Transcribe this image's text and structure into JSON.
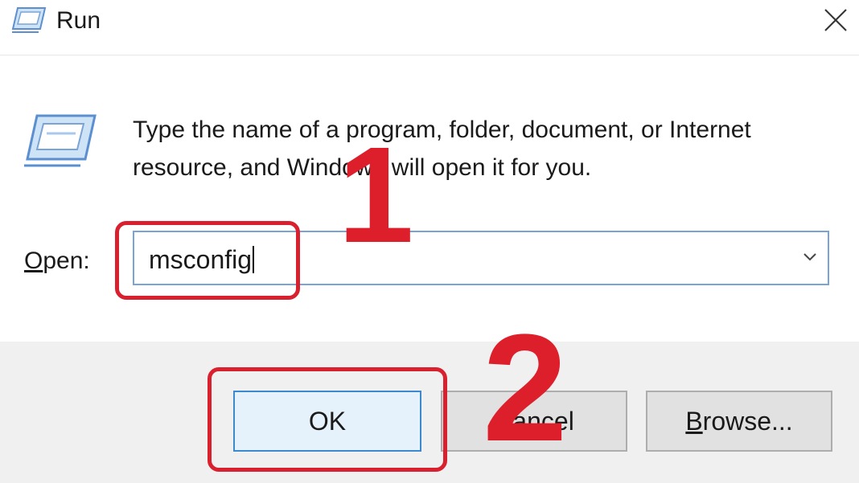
{
  "window": {
    "title": "Run",
    "icon": "run-app-icon",
    "close_icon": "close-icon"
  },
  "dialog": {
    "description": "Type the name of a program, folder, document, or Internet resource, and Windows will open it for you.",
    "description_visible": "Type the name of a program, folder, document, or Internet resource and Windows will open it for you.",
    "open_label_accel": "O",
    "open_label_rest": "pen:",
    "open_value": "msconfig",
    "dropdown_icon": "chevron-down-icon"
  },
  "buttons": {
    "ok": "OK",
    "cancel": "Cancel",
    "browse_accel": "B",
    "browse_rest": "rowse..."
  },
  "annotations": {
    "step_1": "1",
    "step_2": "2",
    "highlight_color": "#d9202e"
  }
}
